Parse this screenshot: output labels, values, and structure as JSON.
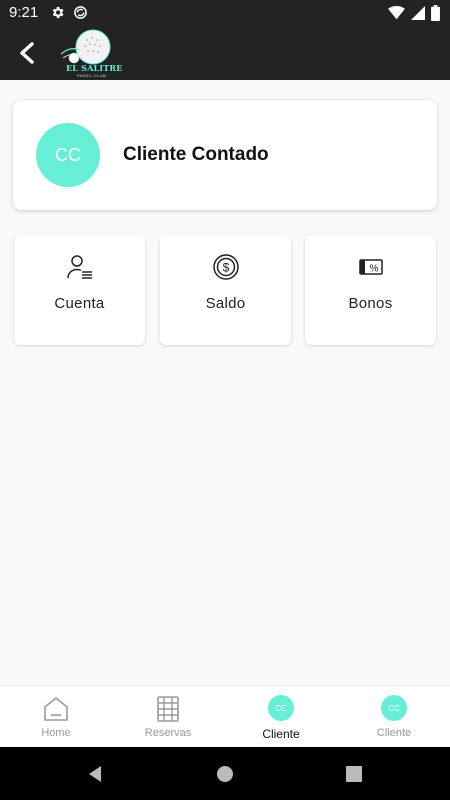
{
  "status_bar": {
    "time": "9:21",
    "left_icons": [
      "gear-icon",
      "at-sign-icon"
    ],
    "right_icons": [
      "wifi-icon",
      "signal-icon",
      "battery-icon"
    ]
  },
  "app_bar": {
    "logo_text": "EL SALITRE",
    "logo_subtext": "PADEL CLUB"
  },
  "client": {
    "initials": "CC",
    "name": "Cliente Contado"
  },
  "tiles": [
    {
      "label": "Cuenta",
      "icon": "user-list-icon"
    },
    {
      "label": "Saldo",
      "icon": "dollar-coin-icon"
    },
    {
      "label": "Bonos",
      "icon": "percent-voucher-icon"
    }
  ],
  "bottom_nav": {
    "items": [
      {
        "label": "Home",
        "icon": "home-icon",
        "active": false
      },
      {
        "label": "Reservas",
        "icon": "calendar-grid-icon",
        "active": false
      },
      {
        "label": "Cliente",
        "avatar": "CC",
        "active": true
      },
      {
        "label": "Cliente",
        "avatar": "CC",
        "active": false
      }
    ]
  },
  "colors": {
    "accent": "#66eed7",
    "app_bar": "#232323",
    "background": "#f9f9f9"
  }
}
